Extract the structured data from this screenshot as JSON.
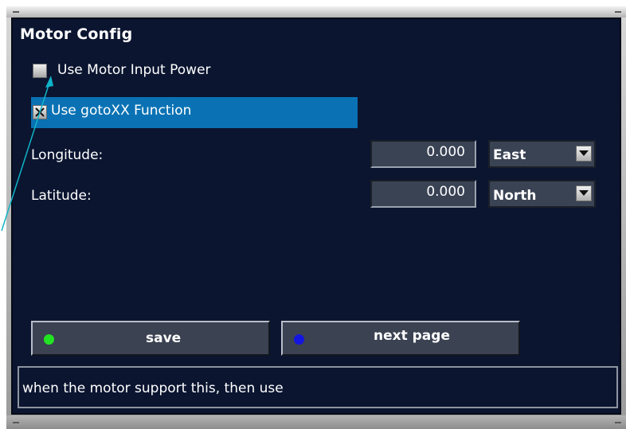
{
  "window": {
    "title": "Motor Config"
  },
  "options": {
    "motor_input_power": {
      "label": "Use Motor Input Power",
      "checked": false
    },
    "gotoxx": {
      "label": "Use gotoXX Function",
      "checked": true,
      "highlighted": true
    }
  },
  "longitude": {
    "label": "Longitude:",
    "value": "0.000",
    "direction": "East"
  },
  "latitude": {
    "label": "Latitude:",
    "value": "0.000",
    "direction": "North"
  },
  "buttons": {
    "save": {
      "label": "save",
      "dot_color": "#22e422"
    },
    "next_page": {
      "label": "next page",
      "dot_color": "#1515e0"
    }
  },
  "status_bar": {
    "text": "when the motor support this, then use"
  },
  "colors": {
    "panel_bg": "#0b1530",
    "highlight": "#0a72b4"
  },
  "icons": [
    "checkbox-unchecked-icon",
    "checkbox-checked-icon",
    "dropdown-arrow-icon",
    "pointer-arrow-icon"
  ]
}
